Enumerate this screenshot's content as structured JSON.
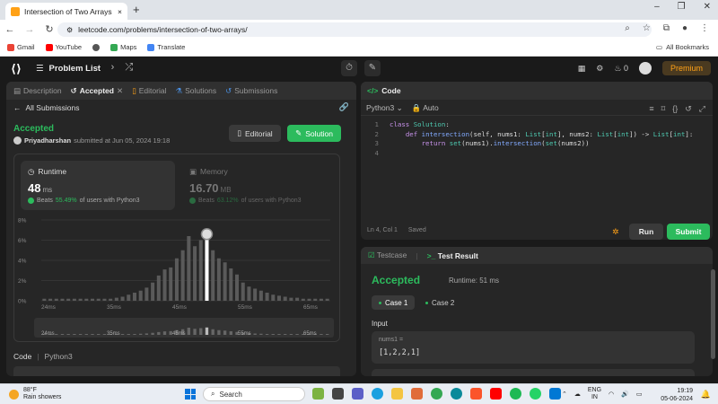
{
  "browser": {
    "tab_title": "Intersection of Two Arrays - Lee",
    "tab_close": "×",
    "new_tab": "+",
    "url": "leetcode.com/problems/intersection-of-two-arrays/",
    "win_min": "–",
    "win_max": "❐",
    "win_close": "✕"
  },
  "bookmarks": {
    "items": [
      "Gmail",
      "YouTube",
      "Maps",
      "Translate"
    ],
    "all_label": "All Bookmarks"
  },
  "lc_nav": {
    "problem_list": "Problem List",
    "streak": "0",
    "premium": "Premium"
  },
  "left": {
    "tabs": [
      {
        "label": "Description"
      },
      {
        "label": "Accepted"
      },
      {
        "label": "Editorial"
      },
      {
        "label": "Solutions"
      },
      {
        "label": "Submissions"
      }
    ],
    "back_label": "All Submissions",
    "status": "Accepted",
    "user": "Priyadharshan",
    "submitted_text": "submitted at Jun 05, 2024 19:18",
    "editorial_btn": "Editorial",
    "solution_btn": "Solution",
    "runtime": {
      "label": "Runtime",
      "value": "48",
      "unit": "ms",
      "beats_prefix": "Beats",
      "beats_pct": "55.49%",
      "beats_suffix": "of users with Python3"
    },
    "memory": {
      "label": "Memory",
      "value": "16.70",
      "unit": "MB",
      "beats_prefix": "Beats",
      "beats_pct": "63.12%",
      "beats_suffix": "of users with Python3"
    },
    "code_label": "Code",
    "code_lang": "Python3"
  },
  "chart_data": {
    "type": "bar",
    "y_ticks": [
      "8%",
      "6%",
      "4%",
      "2%",
      "0%"
    ],
    "ylim": [
      0,
      8
    ],
    "x_ticks": [
      "24ms",
      "35ms",
      "45ms",
      "55ms",
      "65ms"
    ],
    "mini_x_ticks": [
      "24ms",
      "35ms",
      "45ms",
      "55ms",
      "65ms"
    ],
    "values": [
      0.2,
      0.2,
      0.2,
      0.2,
      0.2,
      0.2,
      0.2,
      0.2,
      0.2,
      0.2,
      0.2,
      0.2,
      0.3,
      0.4,
      0.6,
      0.8,
      1.0,
      1.3,
      1.8,
      2.5,
      3.1,
      3.3,
      4.2,
      5.0,
      6.4,
      5.4,
      6.0,
      6.6,
      5.0,
      4.2,
      3.8,
      3.2,
      2.6,
      1.8,
      1.4,
      1.2,
      1.0,
      0.8,
      0.6,
      0.5,
      0.4,
      0.3,
      0.3,
      0.2,
      0.2,
      0.2,
      0.2,
      0.2
    ],
    "highlight_index": 27
  },
  "code": {
    "header": "Code",
    "language": "Python3",
    "auto": "Auto",
    "lines": [
      [
        "1",
        "class Solution:"
      ],
      [
        "2",
        "    def intersection(self, nums1: List[int], nums2: List[int]) -> List[int]:"
      ],
      [
        "3",
        "        return set(nums1).intersection(set(nums2))"
      ],
      [
        "4",
        ""
      ]
    ],
    "cursor": "Ln 4, Col 1",
    "saved": "Saved",
    "run": "Run",
    "submit": "Submit"
  },
  "result": {
    "tab_testcase": "Testcase",
    "tab_result": "Test Result",
    "status": "Accepted",
    "runtime": "Runtime: 51 ms",
    "case1": "Case 1",
    "case2": "Case 2",
    "input_label": "Input",
    "input_name": "nums1 =",
    "input_value": "[1,2,2,1]"
  },
  "taskbar": {
    "temp": "88°F",
    "weather": "Rain showers",
    "search": "Search",
    "lang_top": "ENG",
    "lang_bottom": "IN",
    "time": "19:19",
    "date": "05-06-2024"
  }
}
